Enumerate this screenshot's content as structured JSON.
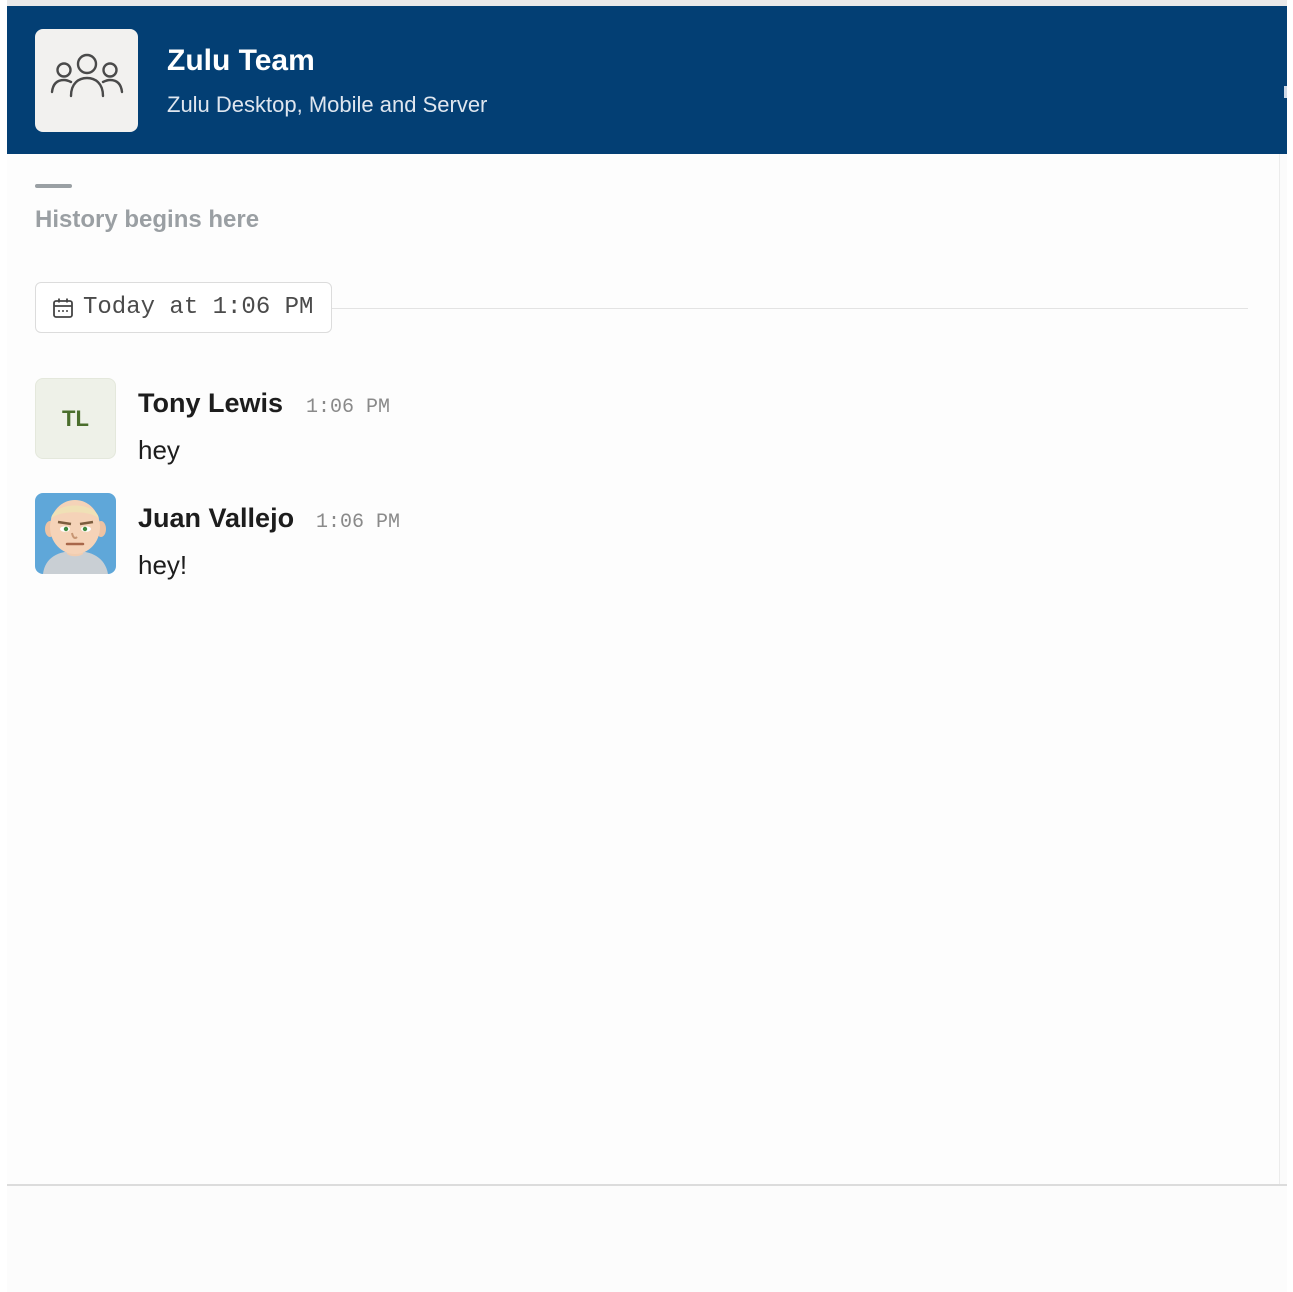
{
  "header": {
    "title": "Zulu Team",
    "subtitle": "Zulu Desktop, Mobile and Server",
    "icon": "group-people-icon",
    "background_color": "#033f74"
  },
  "history": {
    "label": "History begins here"
  },
  "date_divider": {
    "label": "Today at 1:06 PM",
    "icon": "calendar-icon"
  },
  "messages": [
    {
      "sender": "Tony Lewis",
      "initials": "TL",
      "time": "1:06 PM",
      "text": "hey"
    },
    {
      "sender": "Juan Vallejo",
      "time": "1:06 PM",
      "text": "hey!",
      "avatar": "cartoon-avatar"
    }
  ]
}
